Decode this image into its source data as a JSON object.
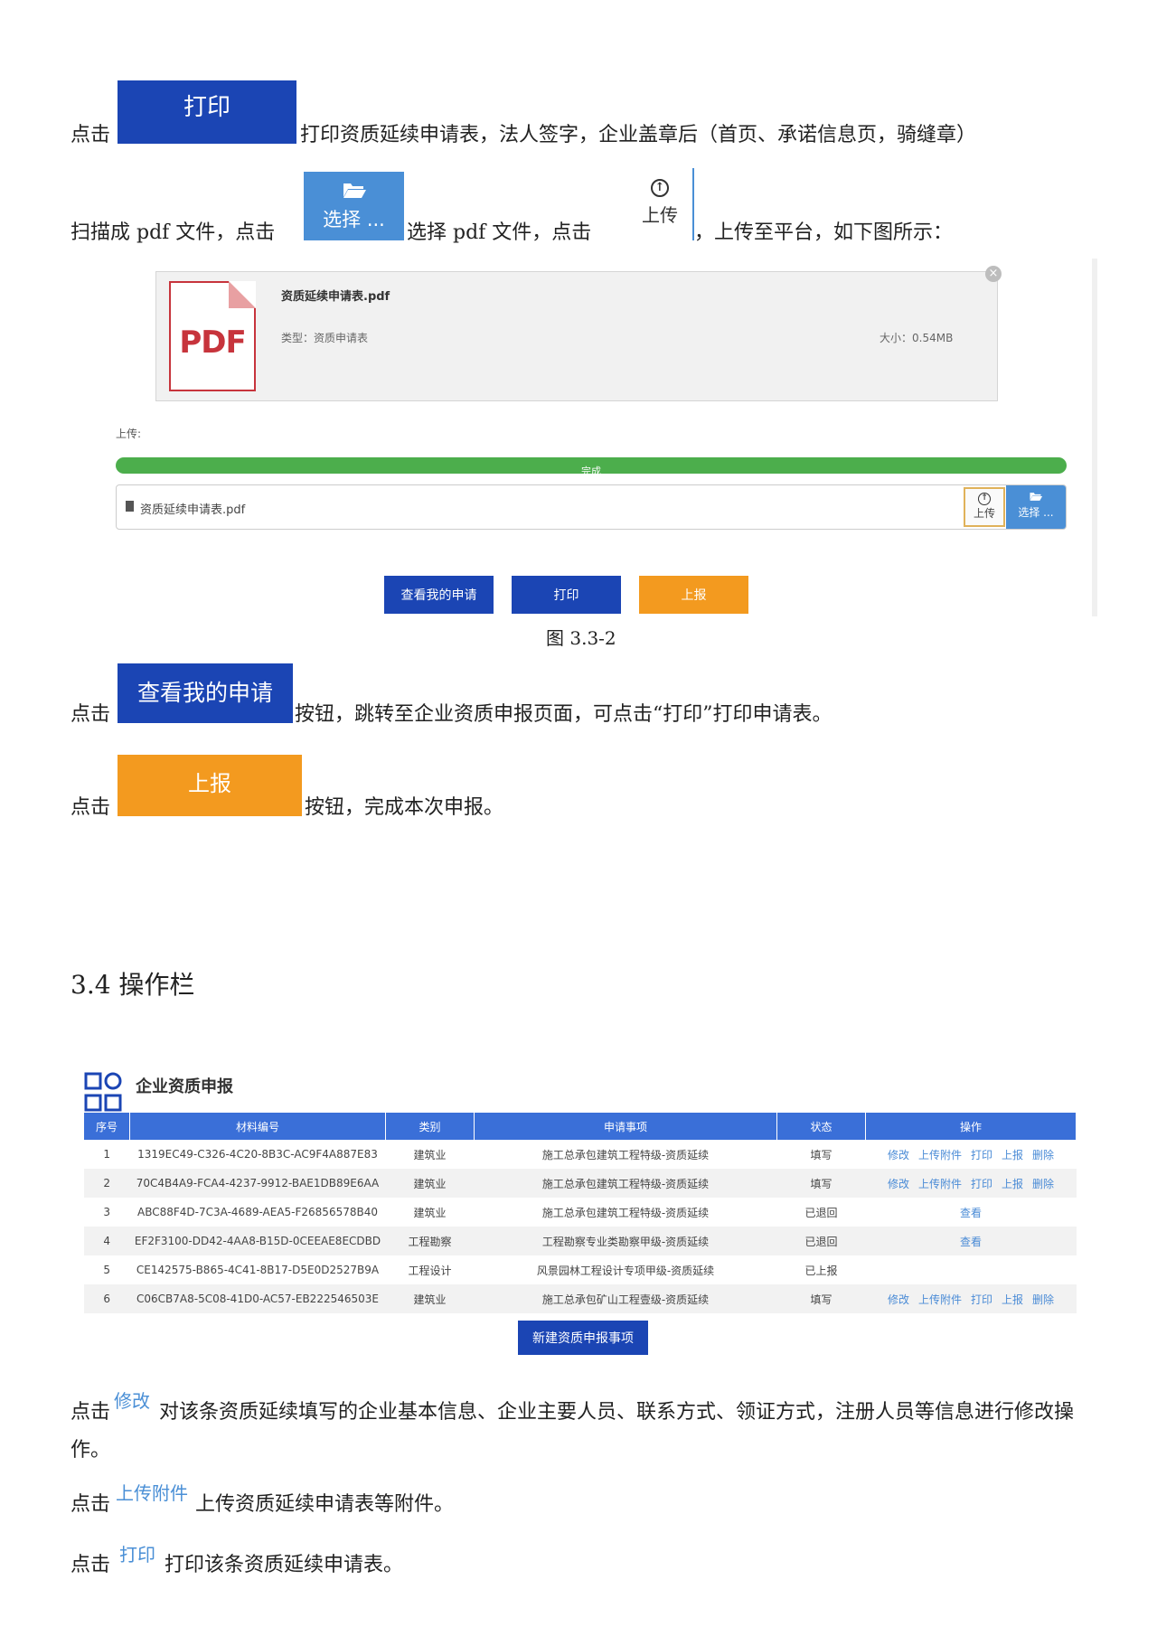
{
  "para1": {
    "prefix": "点击",
    "button": "打印",
    "text": "打印资质延续申请表，法人签字，企业盖章后（首页、承诺信息页，骑缝章）"
  },
  "para2": {
    "prefix": "扫描成 pdf 文件，点击",
    "choose_button": "选择 ...",
    "middle": "选择 pdf 文件，点击",
    "upload_button": "上传",
    "suffix": "，上传至平台，如下图所示："
  },
  "upload_panel": {
    "file_name": "资质延续申请表.pdf",
    "pdf_label": "PDF",
    "type_text": "类型：资质申请表",
    "size_text": "大小：0.54MB",
    "upload_label": "上传:",
    "progress_text": "完成",
    "progress": 1.0,
    "input_value": "资质延续申请表.pdf",
    "upload_btn": "上传",
    "choose_btn": "选择 ...",
    "btn_view": "查看我的申请",
    "btn_print": "打印",
    "btn_report": "上报"
  },
  "figure_caption": "图 3.3-2",
  "para3": {
    "prefix": "点击",
    "button": "查看我的申请",
    "text": "按钮，跳转至企业资质申报页面，可点击“打印”打印申请表。"
  },
  "para4": {
    "prefix": "点击",
    "button": "上报",
    "text": "按钮，完成本次申报。"
  },
  "section_heading": "3.4 操作栏",
  "table_panel": {
    "title": "企业资质申报",
    "headers": [
      "序号",
      "材料编号",
      "类别",
      "申请事项",
      "状态",
      "操作"
    ],
    "rows": [
      {
        "no": "1",
        "code": "1319EC49-C326-4C20-8B3C-AC9F4A887E83",
        "cat": "建筑业",
        "item": "施工总承包建筑工程特级-资质延续",
        "status": "填写",
        "ops": [
          "修改",
          "上传附件",
          "打印",
          "上报",
          "删除"
        ]
      },
      {
        "no": "2",
        "code": "70C4B4A9-FCA4-4237-9912-BAE1DB89E6AA",
        "cat": "建筑业",
        "item": "施工总承包建筑工程特级-资质延续",
        "status": "填写",
        "ops": [
          "修改",
          "上传附件",
          "打印",
          "上报",
          "删除"
        ]
      },
      {
        "no": "3",
        "code": "ABC88F4D-7C3A-4689-AEA5-F26856578B40",
        "cat": "建筑业",
        "item": "施工总承包建筑工程特级-资质延续",
        "status": "已退回",
        "ops": [
          "查看"
        ]
      },
      {
        "no": "4",
        "code": "EF2F3100-DD42-4AA8-B15D-0CEEAE8ECDBD",
        "cat": "工程勘察",
        "item": "工程勘察专业类勘察甲级-资质延续",
        "status": "已退回",
        "ops": [
          "查看"
        ]
      },
      {
        "no": "5",
        "code": "CE142575-B865-4C41-8B17-D5E0D2527B9A",
        "cat": "工程设计",
        "item": "风景园林工程设计专项甲级-资质延续",
        "status": "已上报",
        "ops": []
      },
      {
        "no": "6",
        "code": "C06CB7A8-5C08-41D0-AC57-EB222546503E",
        "cat": "建筑业",
        "item": "施工总承包矿山工程壹级-资质延续",
        "status": "填写",
        "ops": [
          "修改",
          "上传附件",
          "打印",
          "上报",
          "删除"
        ]
      }
    ],
    "new_button": "新建资质申报事项"
  },
  "para5": {
    "prefix": "点击",
    "link": "修改",
    "text": "对该条资质延续填写的企业基本信息、企业主要人员、联系方式、领证方式，注册人员等信息进行修改操",
    "text2": "作。"
  },
  "para6": {
    "prefix": "点击",
    "link": "上传附件",
    "text": "上传资质延续申请表等附件。"
  },
  "para7": {
    "prefix": "点击",
    "link": "打印",
    "text": "打印该条资质延续申请表。"
  }
}
